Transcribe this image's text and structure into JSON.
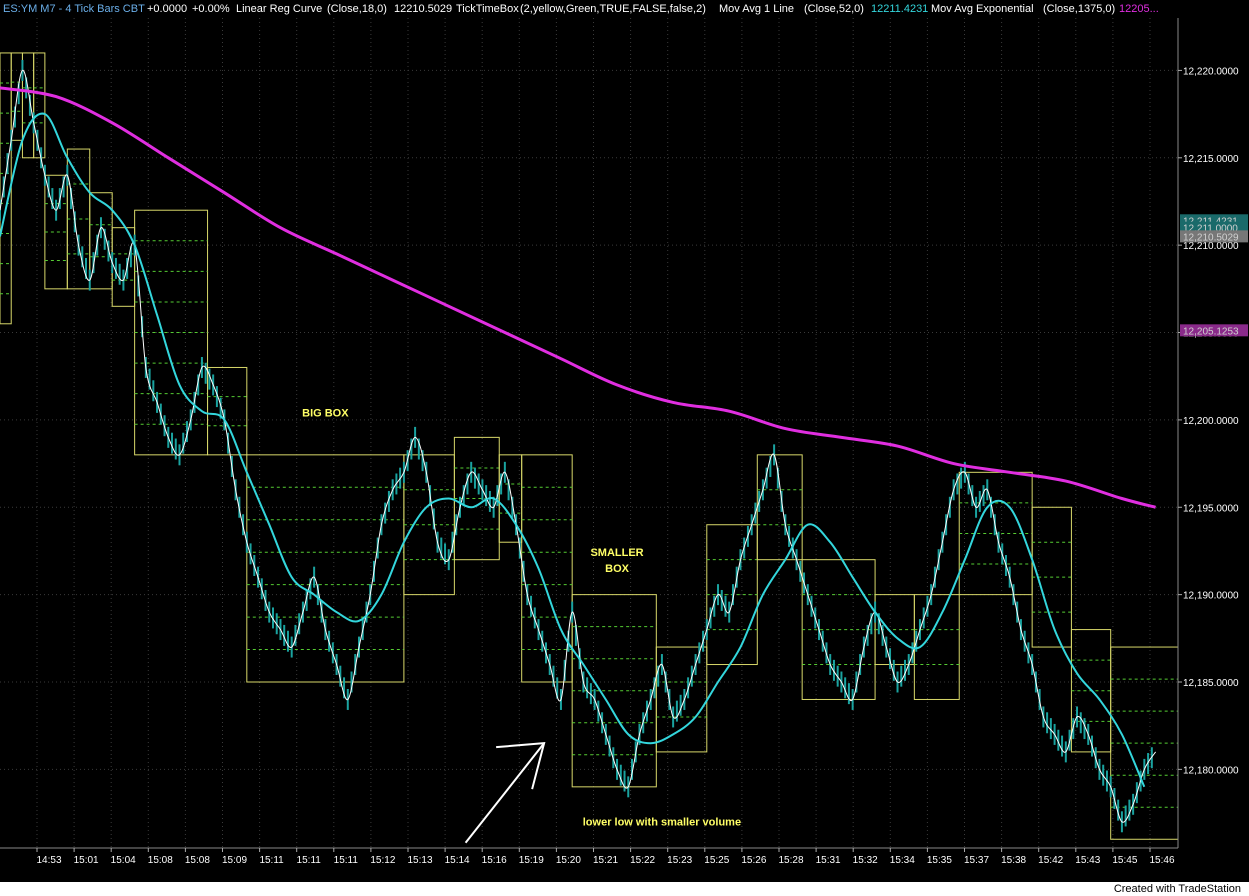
{
  "header": {
    "symbol": "ES:YM M7 - 4 Tick Bars  CBT",
    "change": "+0.0000",
    "change_pct": "+0.00%",
    "study1_name": "Linear Reg Curve",
    "study1_params": "(Close,18,0)",
    "study1_value": "12210.5029",
    "study2_name": "TickTimeBox",
    "study2_params": "(2,yellow,Green,TRUE,FALSE,false,2)",
    "study3_name": "Mov Avg 1 Line",
    "study3_params": "(Close,52,0)",
    "study3_value": "12211.4231",
    "study4_name": "Mov Avg Exponential",
    "study4_params": "(Close,1375,0)",
    "study4_value": "12205..."
  },
  "footer": {
    "credit": "Created with TradeStation"
  },
  "colors": {
    "background": "#000000",
    "price": "#ffffff",
    "bars": "#1aa3a0",
    "ma52": "#33d6dc",
    "ema1375": "#e02ee0",
    "box": "#d8d86a",
    "box_levels": "#55cc33",
    "grid": "#3a3a3a",
    "label_yellow": "#ffff66",
    "arrow": "#ffffff"
  },
  "chart_data": {
    "type": "line",
    "ylim": [
      12175.5,
      12223
    ],
    "ytick_values": [
      12180,
      12185,
      12190,
      12195,
      12200,
      12205,
      12210,
      12215,
      12220
    ],
    "ytick_labels": [
      "12,180.0000",
      "12,185.0000",
      "12,190.0000",
      "12,195.0000",
      "12,200.0000",
      "12,205.0000",
      "12,210.0000",
      "12,215.0000",
      "12,220.0000"
    ],
    "xtick_labels": [
      "14:53",
      "15:01",
      "15:04",
      "15:08",
      "15:08",
      "15:09",
      "15:11",
      "15:11",
      "15:11",
      "15:12",
      "15:13",
      "15:14",
      "15:16",
      "15:19",
      "15:20",
      "15:21",
      "15:22",
      "15:23",
      "15:25",
      "15:26",
      "15:28",
      "15:31",
      "15:32",
      "15:34",
      "15:35",
      "15:37",
      "15:38",
      "15:42",
      "15:43",
      "15:45",
      "15:46"
    ],
    "price_tags": [
      {
        "label": "12,211.4231",
        "value": 12211.4231,
        "color": "#1a6a6a"
      },
      {
        "label": "12,211.0000",
        "value": 12211.0,
        "color": "#1a6a6a"
      },
      {
        "label": "12,210.5029",
        "value": 12210.5029,
        "color": "#777777"
      },
      {
        "label": "12,205.1253",
        "value": 12205.1253,
        "color": "#8a2a8a"
      }
    ],
    "series": [
      {
        "name": "Close",
        "type": "price",
        "points": [
          [
            0,
            12212
          ],
          [
            2,
            12216
          ],
          [
            4,
            12220
          ],
          [
            6,
            12217
          ],
          [
            8,
            12214
          ],
          [
            10,
            12212
          ],
          [
            12,
            12214
          ],
          [
            14,
            12210
          ],
          [
            16,
            12208
          ],
          [
            18,
            12211
          ],
          [
            20,
            12209
          ],
          [
            22,
            12208
          ],
          [
            24,
            12210
          ],
          [
            26,
            12203
          ],
          [
            28,
            12201
          ],
          [
            30,
            12199
          ],
          [
            32,
            12198
          ],
          [
            34,
            12200
          ],
          [
            36,
            12203
          ],
          [
            38,
            12202
          ],
          [
            40,
            12200
          ],
          [
            42,
            12196
          ],
          [
            44,
            12193
          ],
          [
            46,
            12191
          ],
          [
            48,
            12189
          ],
          [
            50,
            12188
          ],
          [
            52,
            12187
          ],
          [
            54,
            12189
          ],
          [
            56,
            12191
          ],
          [
            58,
            12188
          ],
          [
            60,
            12186
          ],
          [
            62,
            12184
          ],
          [
            64,
            12187
          ],
          [
            66,
            12190
          ],
          [
            68,
            12194
          ],
          [
            70,
            12196
          ],
          [
            72,
            12197
          ],
          [
            74,
            12199
          ],
          [
            76,
            12197
          ],
          [
            78,
            12193
          ],
          [
            80,
            12192
          ],
          [
            82,
            12195
          ],
          [
            84,
            12197
          ],
          [
            86,
            12196
          ],
          [
            88,
            12195
          ],
          [
            90,
            12197
          ],
          [
            92,
            12194
          ],
          [
            94,
            12190
          ],
          [
            96,
            12188
          ],
          [
            98,
            12186
          ],
          [
            100,
            12184
          ],
          [
            102,
            12189
          ],
          [
            104,
            12185
          ],
          [
            106,
            12184
          ],
          [
            108,
            12182
          ],
          [
            110,
            12180
          ],
          [
            112,
            12179
          ],
          [
            114,
            12182
          ],
          [
            116,
            12184
          ],
          [
            118,
            12186
          ],
          [
            120,
            12183
          ],
          [
            122,
            12184
          ],
          [
            124,
            12186
          ],
          [
            126,
            12188
          ],
          [
            128,
            12190
          ],
          [
            130,
            12189
          ],
          [
            132,
            12192
          ],
          [
            134,
            12194
          ],
          [
            136,
            12196
          ],
          [
            138,
            12198
          ],
          [
            140,
            12194
          ],
          [
            142,
            12192
          ],
          [
            144,
            12190
          ],
          [
            146,
            12188
          ],
          [
            148,
            12186
          ],
          [
            150,
            12185
          ],
          [
            152,
            12184
          ],
          [
            154,
            12187
          ],
          [
            156,
            12189
          ],
          [
            158,
            12187
          ],
          [
            160,
            12185
          ],
          [
            162,
            12186
          ],
          [
            164,
            12188
          ],
          [
            166,
            12190
          ],
          [
            168,
            12193
          ],
          [
            170,
            12196
          ],
          [
            172,
            12197
          ],
          [
            174,
            12195
          ],
          [
            176,
            12196
          ],
          [
            178,
            12193
          ],
          [
            180,
            12191
          ],
          [
            182,
            12188
          ],
          [
            184,
            12186
          ],
          [
            186,
            12183
          ],
          [
            188,
            12182
          ],
          [
            190,
            12181
          ],
          [
            192,
            12183
          ],
          [
            194,
            12182
          ],
          [
            196,
            12180
          ],
          [
            198,
            12179
          ],
          [
            200,
            12177
          ],
          [
            202,
            12178
          ],
          [
            204,
            12180
          ],
          [
            206,
            12181
          ]
        ]
      },
      {
        "name": "Mov Avg 1 Line",
        "type": "ma",
        "points": [
          [
            0,
            12210.5
          ],
          [
            4,
            12216
          ],
          [
            8,
            12217.5
          ],
          [
            12,
            12215
          ],
          [
            16,
            12213
          ],
          [
            20,
            12212
          ],
          [
            24,
            12210
          ],
          [
            28,
            12206
          ],
          [
            32,
            12202
          ],
          [
            36,
            12200.5
          ],
          [
            40,
            12200
          ],
          [
            44,
            12197
          ],
          [
            48,
            12194
          ],
          [
            52,
            12191
          ],
          [
            56,
            12190
          ],
          [
            60,
            12189
          ],
          [
            64,
            12188.5
          ],
          [
            68,
            12190
          ],
          [
            72,
            12193
          ],
          [
            76,
            12195
          ],
          [
            80,
            12195.5
          ],
          [
            84,
            12195
          ],
          [
            88,
            12195.5
          ],
          [
            92,
            12194
          ],
          [
            96,
            12191.5
          ],
          [
            100,
            12188
          ],
          [
            104,
            12186
          ],
          [
            108,
            12184
          ],
          [
            112,
            12182
          ],
          [
            116,
            12181.5
          ],
          [
            120,
            12182
          ],
          [
            124,
            12183
          ],
          [
            128,
            12185
          ],
          [
            132,
            12187
          ],
          [
            136,
            12190
          ],
          [
            140,
            12192
          ],
          [
            144,
            12194
          ],
          [
            148,
            12193
          ],
          [
            152,
            12191
          ],
          [
            156,
            12189
          ],
          [
            160,
            12187.5
          ],
          [
            164,
            12187
          ],
          [
            168,
            12189
          ],
          [
            172,
            12192
          ],
          [
            176,
            12195
          ],
          [
            180,
            12195
          ],
          [
            184,
            12192
          ],
          [
            188,
            12188
          ],
          [
            192,
            12185.5
          ],
          [
            196,
            12184
          ],
          [
            200,
            12182
          ],
          [
            204,
            12179
          ]
        ]
      },
      {
        "name": "Mov Avg Exponential",
        "type": "ema",
        "points": [
          [
            0,
            12219
          ],
          [
            10,
            12218.5
          ],
          [
            20,
            12217
          ],
          [
            30,
            12215
          ],
          [
            40,
            12213
          ],
          [
            50,
            12211
          ],
          [
            60,
            12209.5
          ],
          [
            70,
            12208
          ],
          [
            80,
            12206.5
          ],
          [
            90,
            12205
          ],
          [
            100,
            12203.5
          ],
          [
            110,
            12202
          ],
          [
            120,
            12201
          ],
          [
            130,
            12200.5
          ],
          [
            140,
            12199.5
          ],
          [
            150,
            12199
          ],
          [
            160,
            12198.5
          ],
          [
            170,
            12197.5
          ],
          [
            180,
            12197
          ],
          [
            190,
            12196.5
          ],
          [
            200,
            12195.5
          ],
          [
            206,
            12195
          ]
        ]
      }
    ],
    "boxes": [
      {
        "x0": 0,
        "x1": 2,
        "low": 12205.5,
        "high": 12221
      },
      {
        "x0": 2,
        "x1": 4,
        "low": 12216,
        "high": 12221
      },
      {
        "x0": 4,
        "x1": 6,
        "low": 12215,
        "high": 12221
      },
      {
        "x0": 6,
        "x1": 8,
        "low": 12215,
        "high": 12221
      },
      {
        "x0": 8,
        "x1": 12,
        "low": 12207.5,
        "high": 12214
      },
      {
        "x0": 12,
        "x1": 16,
        "low": 12207.5,
        "high": 12215.5
      },
      {
        "x0": 16,
        "x1": 20,
        "low": 12207.5,
        "high": 12213
      },
      {
        "x0": 20,
        "x1": 24,
        "low": 12206.5,
        "high": 12211
      },
      {
        "x0": 24,
        "x1": 37,
        "low": 12198,
        "high": 12212
      },
      {
        "x0": 37,
        "x1": 44,
        "low": 12198,
        "high": 12203
      },
      {
        "x0": 44,
        "x1": 72,
        "low": 12185,
        "high": 12198
      },
      {
        "x0": 72,
        "x1": 81,
        "low": 12190,
        "high": 12198
      },
      {
        "x0": 81,
        "x1": 89,
        "low": 12192,
        "high": 12199
      },
      {
        "x0": 89,
        "x1": 93,
        "low": 12193,
        "high": 12198
      },
      {
        "x0": 93,
        "x1": 102,
        "low": 12185,
        "high": 12198
      },
      {
        "x0": 102,
        "x1": 117,
        "low": 12179,
        "high": 12190
      },
      {
        "x0": 117,
        "x1": 126,
        "low": 12181,
        "high": 12187
      },
      {
        "x0": 126,
        "x1": 135,
        "low": 12186,
        "high": 12194
      },
      {
        "x0": 135,
        "x1": 143,
        "low": 12192,
        "high": 12198
      },
      {
        "x0": 143,
        "x1": 156,
        "low": 12184,
        "high": 12192
      },
      {
        "x0": 156,
        "x1": 163,
        "low": 12186,
        "high": 12190
      },
      {
        "x0": 163,
        "x1": 171,
        "low": 12184,
        "high": 12190
      },
      {
        "x0": 171,
        "x1": 184,
        "low": 12190,
        "high": 12197
      },
      {
        "x0": 184,
        "x1": 191,
        "low": 12187,
        "high": 12195
      },
      {
        "x0": 191,
        "x1": 198,
        "low": 12181,
        "high": 12188
      },
      {
        "x0": 198,
        "x1": 210,
        "low": 12176,
        "high": 12187
      }
    ],
    "annotations": [
      {
        "text": "BIG BOX",
        "x": 58,
        "y": 12200.2
      },
      {
        "text": "SMALLER",
        "x": 110,
        "y": 12192.2
      },
      {
        "text": "BOX",
        "x": 110,
        "y": 12191.3
      },
      {
        "text": "lower low with smaller volume",
        "x": 118,
        "y": 12176.8
      }
    ],
    "arrow": {
      "from": [
        83,
        12175.8
      ],
      "to": [
        97,
        12181.5
      ]
    }
  }
}
